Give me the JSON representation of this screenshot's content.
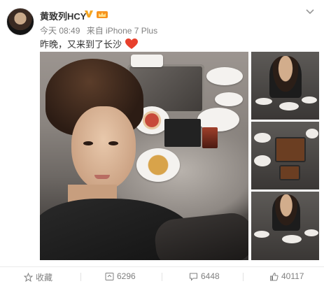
{
  "user": {
    "name": "黄致列HCY"
  },
  "post": {
    "time": "今天 08:49",
    "source": "来自 iPhone 7 Plus",
    "text": "昨晚，又来到了长沙"
  },
  "actions": {
    "favorite_label": "收藏",
    "repost_count": "6296",
    "comment_count": "6448",
    "like_count": "40117"
  },
  "icons": {
    "verified": "verified-v-icon",
    "vip": "vip-crown-icon",
    "heart": "heart-icon",
    "chevron": "chevron-down-icon",
    "favorite": "star-icon",
    "repost": "repost-icon",
    "comment": "comment-icon",
    "like": "thumbs-up-icon"
  },
  "colors": {
    "verified": "#f5a623",
    "heart": "#e8402c",
    "text": "#333333",
    "muted": "#808080"
  }
}
